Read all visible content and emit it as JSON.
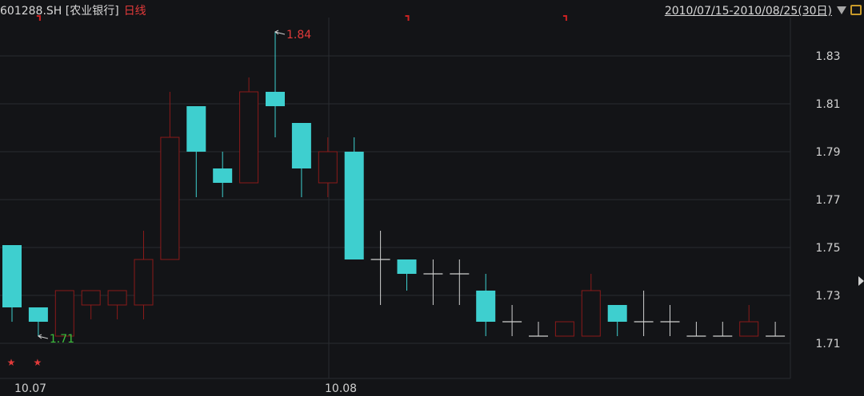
{
  "header": {
    "symbol": "601288.SH [农业银行]",
    "period": "日线",
    "range": "2010/07/15-2010/08/25(30日)"
  },
  "colors": {
    "background": "#131417",
    "up": "#8b1a1a",
    "down": "#3ecfcf",
    "flat": "#d0d0d0",
    "grid": "#2a2c31",
    "axis_text": "#d0d0d0",
    "high_label": "#e23a3a",
    "low_label": "#3cbf3c",
    "star": "#e23a3a",
    "marker": "#cc2222"
  },
  "chart_data": {
    "type": "candlestick",
    "ylim": [
      1.695,
      1.855
    ],
    "y_ticks": [
      "1.83",
      "1.81",
      "1.79",
      "1.77",
      "1.75",
      "1.73",
      "1.71"
    ],
    "x_labels": [
      {
        "label": "10.07",
        "index": 0
      },
      {
        "label": "10.08",
        "index": 12.5
      }
    ],
    "annotations": [
      {
        "text": "1.84",
        "index": 10,
        "value": 1.84,
        "kind": "high"
      },
      {
        "text": "1.71",
        "index": 1,
        "value": 1.713,
        "kind": "low"
      }
    ],
    "stars_under": [
      0,
      1
    ],
    "top_markers": [
      1,
      15,
      21
    ],
    "candles": [
      {
        "o": 1.751,
        "h": 1.751,
        "l": 1.719,
        "c": 1.725
      },
      {
        "o": 1.725,
        "h": 1.725,
        "l": 1.713,
        "c": 1.719
      },
      {
        "o": 1.713,
        "h": 1.732,
        "l": 1.713,
        "c": 1.732
      },
      {
        "o": 1.726,
        "h": 1.732,
        "l": 1.72,
        "c": 1.732
      },
      {
        "o": 1.726,
        "h": 1.732,
        "l": 1.72,
        "c": 1.732
      },
      {
        "o": 1.726,
        "h": 1.757,
        "l": 1.72,
        "c": 1.745
      },
      {
        "o": 1.745,
        "h": 1.815,
        "l": 1.745,
        "c": 1.796
      },
      {
        "o": 1.809,
        "h": 1.809,
        "l": 1.771,
        "c": 1.79
      },
      {
        "o": 1.783,
        "h": 1.79,
        "l": 1.771,
        "c": 1.777
      },
      {
        "o": 1.777,
        "h": 1.821,
        "l": 1.777,
        "c": 1.815
      },
      {
        "o": 1.815,
        "h": 1.84,
        "l": 1.796,
        "c": 1.809
      },
      {
        "o": 1.802,
        "h": 1.802,
        "l": 1.771,
        "c": 1.783
      },
      {
        "o": 1.777,
        "h": 1.796,
        "l": 1.771,
        "c": 1.79
      },
      {
        "o": 1.79,
        "h": 1.796,
        "l": 1.745,
        "c": 1.745
      },
      {
        "o": 1.745,
        "h": 1.757,
        "l": 1.726,
        "c": 1.745
      },
      {
        "o": 1.745,
        "h": 1.745,
        "l": 1.732,
        "c": 1.739
      },
      {
        "o": 1.739,
        "h": 1.745,
        "l": 1.726,
        "c": 1.739
      },
      {
        "o": 1.739,
        "h": 1.745,
        "l": 1.726,
        "c": 1.739
      },
      {
        "o": 1.732,
        "h": 1.739,
        "l": 1.713,
        "c": 1.719
      },
      {
        "o": 1.719,
        "h": 1.726,
        "l": 1.713,
        "c": 1.719
      },
      {
        "o": 1.713,
        "h": 1.719,
        "l": 1.713,
        "c": 1.713
      },
      {
        "o": 1.713,
        "h": 1.719,
        "l": 1.713,
        "c": 1.719
      },
      {
        "o": 1.713,
        "h": 1.739,
        "l": 1.713,
        "c": 1.732
      },
      {
        "o": 1.726,
        "h": 1.726,
        "l": 1.713,
        "c": 1.719
      },
      {
        "o": 1.719,
        "h": 1.732,
        "l": 1.713,
        "c": 1.719
      },
      {
        "o": 1.719,
        "h": 1.726,
        "l": 1.713,
        "c": 1.719
      },
      {
        "o": 1.713,
        "h": 1.719,
        "l": 1.713,
        "c": 1.713
      },
      {
        "o": 1.713,
        "h": 1.719,
        "l": 1.713,
        "c": 1.713
      },
      {
        "o": 1.713,
        "h": 1.726,
        "l": 1.713,
        "c": 1.719
      },
      {
        "o": 1.713,
        "h": 1.719,
        "l": 1.713,
        "c": 1.713
      }
    ]
  }
}
